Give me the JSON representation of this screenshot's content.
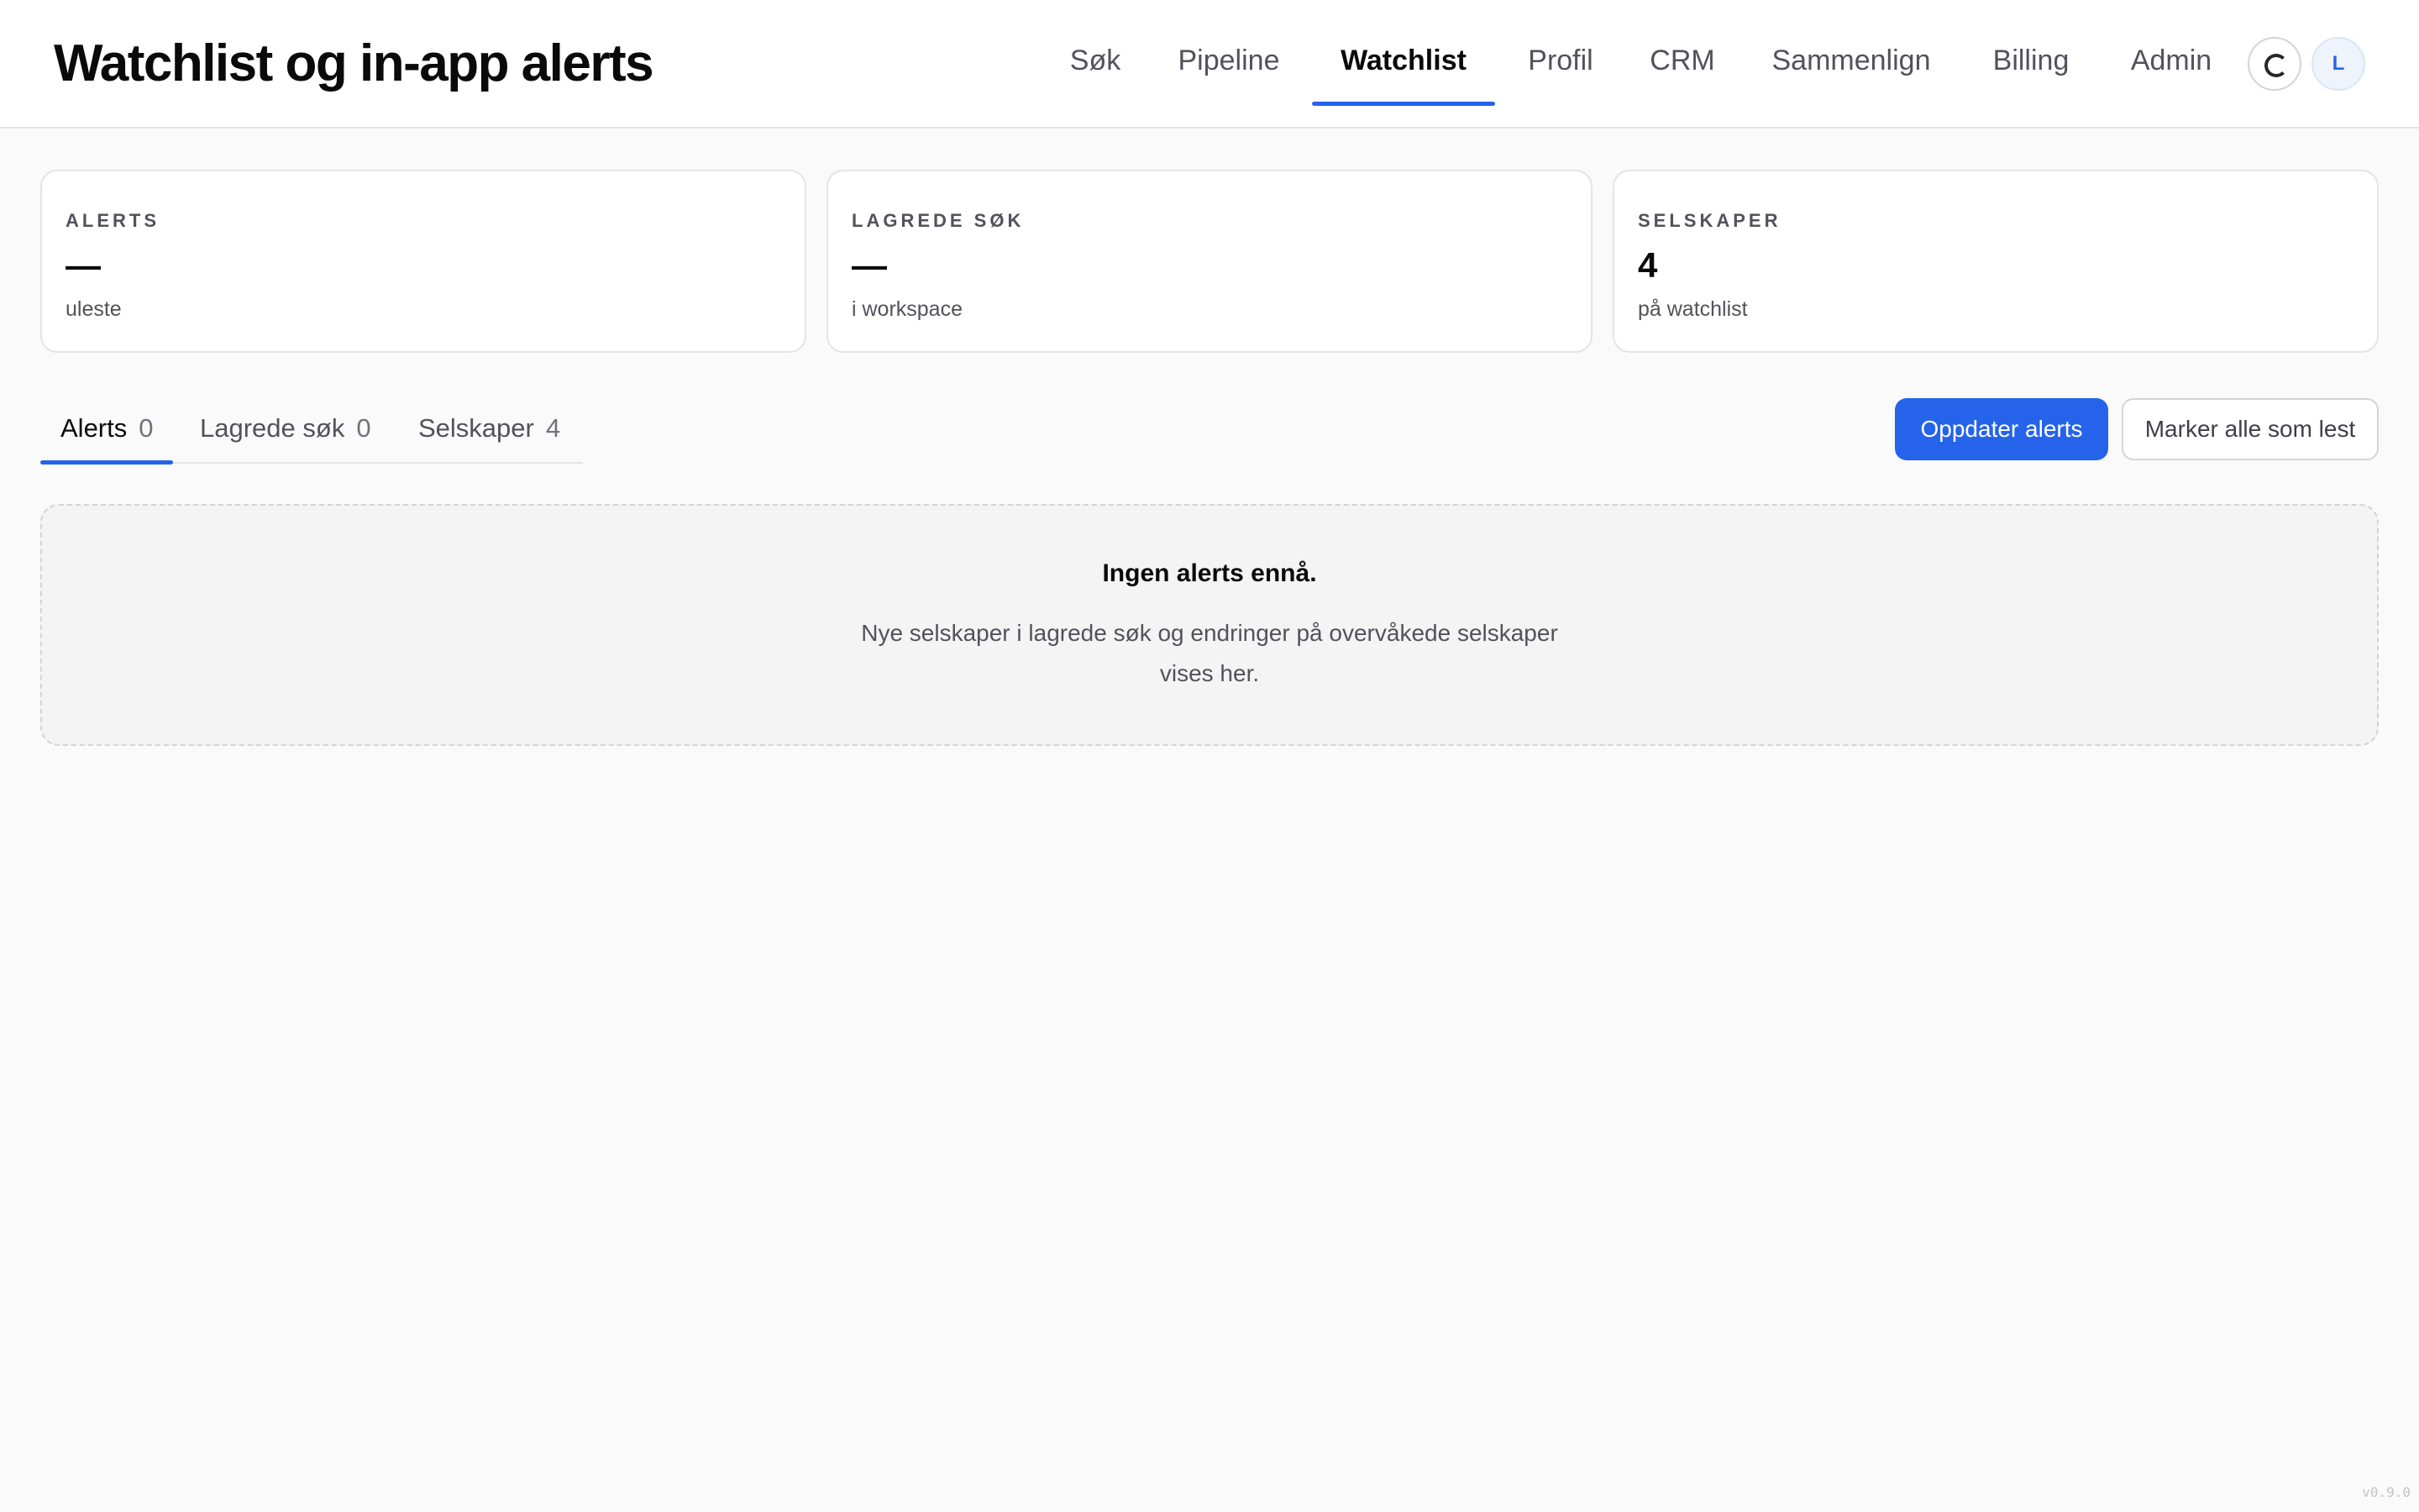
{
  "header": {
    "title": "Watchlist og in-app alerts",
    "nav": [
      {
        "label": "Søk",
        "active": false
      },
      {
        "label": "Pipeline",
        "active": false
      },
      {
        "label": "Watchlist",
        "active": true
      },
      {
        "label": "Profil",
        "active": false
      },
      {
        "label": "CRM",
        "active": false
      },
      {
        "label": "Sammenlign",
        "active": false
      },
      {
        "label": "Billing",
        "active": false
      },
      {
        "label": "Admin",
        "active": false
      }
    ],
    "refresh_icon": "loading-spinner-icon",
    "avatar_initial": "L"
  },
  "stats": [
    {
      "label": "ALERTS",
      "value": "—",
      "sub": "uleste"
    },
    {
      "label": "LAGREDE SØK",
      "value": "—",
      "sub": "i workspace"
    },
    {
      "label": "SELSKAPER",
      "value": "4",
      "sub": "på watchlist"
    }
  ],
  "tabs": [
    {
      "label": "Alerts",
      "count": "0",
      "active": true
    },
    {
      "label": "Lagrede søk",
      "count": "0",
      "active": false
    },
    {
      "label": "Selskaper",
      "count": "4",
      "active": false
    }
  ],
  "actions": {
    "refresh_label": "Oppdater alerts",
    "mark_read_label": "Marker alle som lest"
  },
  "empty_state": {
    "title": "Ingen alerts ennå.",
    "description": "Nye selskaper i lagrede søk og endringer på overvåkede selskaper vises her."
  },
  "version": "v0.9.0",
  "colors": {
    "accent": "#2563eb",
    "background": "#fafafa",
    "text": "#0a0a0a",
    "muted": "#52525b"
  }
}
